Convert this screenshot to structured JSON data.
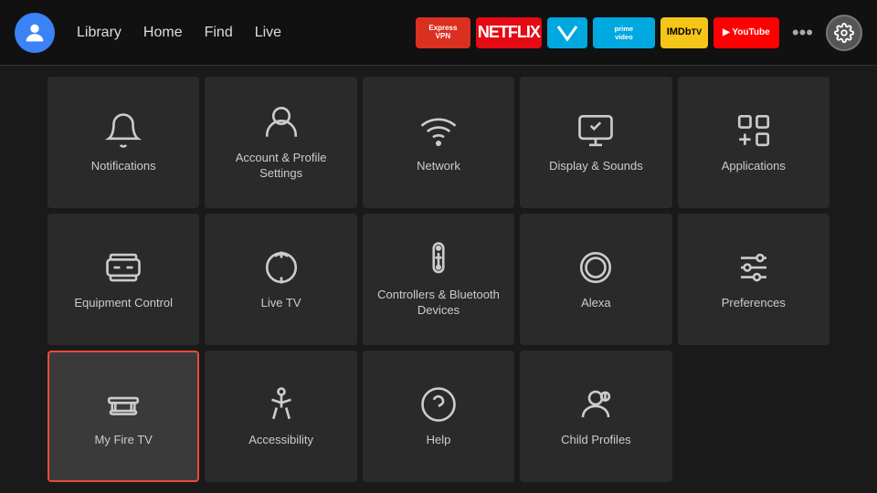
{
  "nav": {
    "links": [
      "Library",
      "Home",
      "Find",
      "Live"
    ],
    "apps": [
      {
        "name": "ExpressVPN",
        "class": "app-expressvpn",
        "label": "Express\nVPN"
      },
      {
        "name": "Netflix",
        "class": "app-netflix",
        "label": "NETFLIX"
      },
      {
        "name": "FreeVee",
        "class": "app-freevee",
        "label": "fv"
      },
      {
        "name": "Prime Video",
        "class": "app-prime",
        "label": "prime\nvideo"
      },
      {
        "name": "IMDb TV",
        "class": "app-imdb",
        "label": "IMDb\nTV"
      },
      {
        "name": "YouTube",
        "class": "app-youtube",
        "label": "▶ YouTube"
      }
    ],
    "dots_label": "•••",
    "settings_label": "⚙"
  },
  "grid": {
    "items": [
      {
        "id": "notifications",
        "label": "Notifications",
        "icon": "bell"
      },
      {
        "id": "account-profile",
        "label": "Account & Profile Settings",
        "icon": "person"
      },
      {
        "id": "network",
        "label": "Network",
        "icon": "wifi"
      },
      {
        "id": "display-sounds",
        "label": "Display & Sounds",
        "icon": "display"
      },
      {
        "id": "applications",
        "label": "Applications",
        "icon": "apps"
      },
      {
        "id": "equipment-control",
        "label": "Equipment Control",
        "icon": "tv"
      },
      {
        "id": "live-tv",
        "label": "Live TV",
        "icon": "antenna"
      },
      {
        "id": "controllers-bluetooth",
        "label": "Controllers & Bluetooth Devices",
        "icon": "remote"
      },
      {
        "id": "alexa",
        "label": "Alexa",
        "icon": "alexa"
      },
      {
        "id": "preferences",
        "label": "Preferences",
        "icon": "sliders"
      },
      {
        "id": "my-fire-tv",
        "label": "My Fire TV",
        "icon": "firetv",
        "selected": true
      },
      {
        "id": "accessibility",
        "label": "Accessibility",
        "icon": "accessibility"
      },
      {
        "id": "help",
        "label": "Help",
        "icon": "help"
      },
      {
        "id": "child-profiles",
        "label": "Child Profiles",
        "icon": "child-profiles"
      }
    ]
  },
  "colors": {
    "accent": "#e74c3c",
    "nav_bg": "#111",
    "grid_bg": "#2a2a2a",
    "selected_border": "#e74c3c"
  }
}
